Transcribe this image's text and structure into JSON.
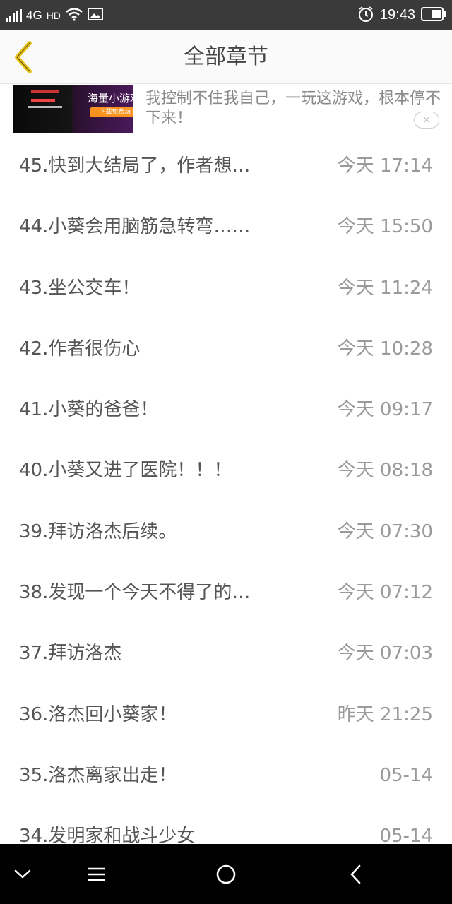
{
  "status_bar": {
    "network": "4G",
    "hd": "HD",
    "time": "19:43",
    "icons": [
      "signal-icon",
      "wifi-icon",
      "image-icon",
      "alarm-icon",
      "battery-icon"
    ]
  },
  "header": {
    "title": "全部章节",
    "back_icon": "chevron-left-icon",
    "accent": "#e8c21a"
  },
  "ad": {
    "image_title": "海量小游戏",
    "image_button": "下载免费玩",
    "text": "我控制不住我自己，一玩这游戏，根本停不下来！",
    "close_icon": "close-icon"
  },
  "chapters": [
    {
      "title": "45.快到大结局了，作者想…",
      "time": "今天 17:14"
    },
    {
      "title": "44.小葵会用脑筋急转弯……",
      "time": "今天 15:50"
    },
    {
      "title": "43.坐公交车！",
      "time": "今天 11:24"
    },
    {
      "title": "42.作者很伤心",
      "time": "今天 10:28"
    },
    {
      "title": "41.小葵的爸爸！",
      "time": "今天 09:17"
    },
    {
      "title": "40.小葵又进了医院！！！",
      "time": "今天 08:18"
    },
    {
      "title": "39.拜访洛杰后续。",
      "time": "今天 07:30"
    },
    {
      "title": "38.发现一个今天不得了的…",
      "time": "今天 07:12"
    },
    {
      "title": "37.拜访洛杰",
      "time": "今天 07:03"
    },
    {
      "title": "36.洛杰回小葵家！",
      "time": "昨天 21:25"
    },
    {
      "title": "35.洛杰离家出走！",
      "time": "05-14"
    },
    {
      "title": "34.发明家和战斗少女",
      "time": "05-14"
    }
  ],
  "nav_bar": {
    "icons": [
      "chevron-down-icon",
      "menu-icon",
      "home-circle-icon",
      "back-icon"
    ]
  }
}
